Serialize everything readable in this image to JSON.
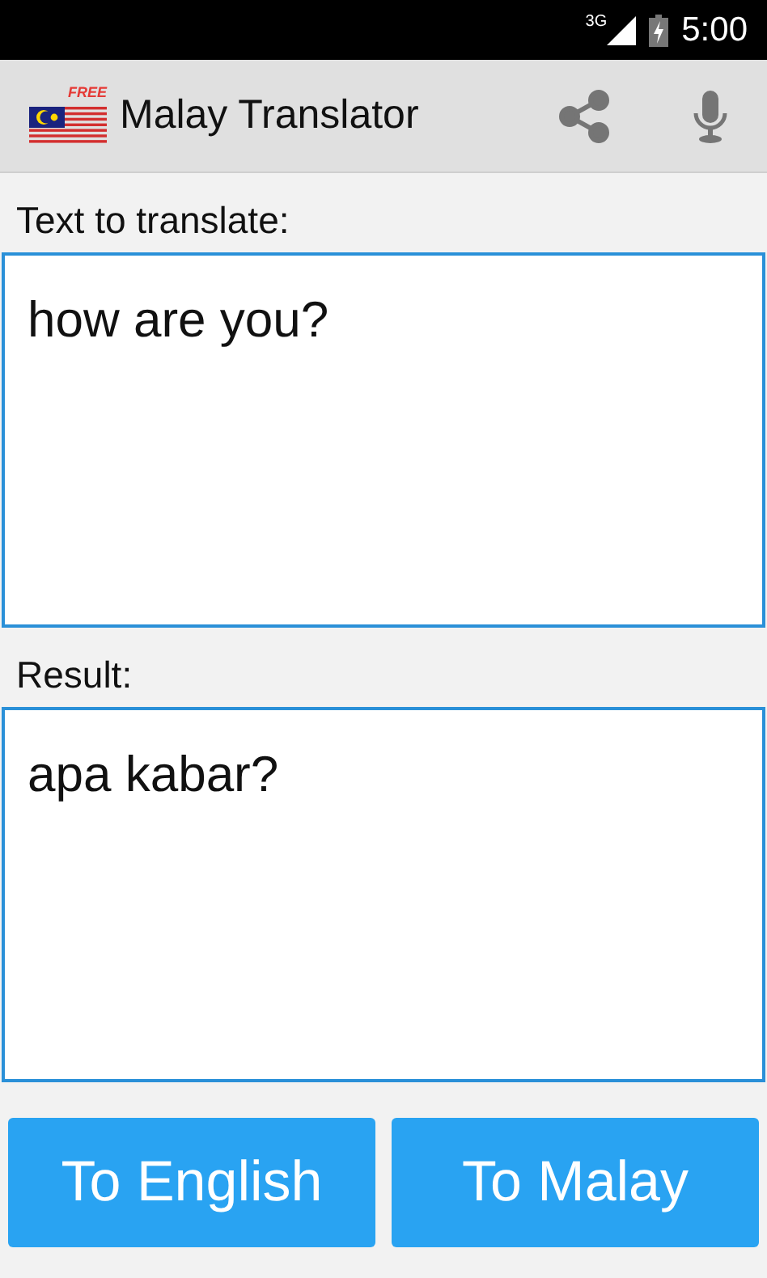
{
  "status_bar": {
    "network": "3G",
    "time": "5:00"
  },
  "app_bar": {
    "logo_badge": "FREE",
    "title": "Malay Translator"
  },
  "input": {
    "label": "Text to translate:",
    "value": "how are you?"
  },
  "result": {
    "label": "Result:",
    "value": "apa kabar?"
  },
  "buttons": [
    "To English",
    "To Malay"
  ]
}
